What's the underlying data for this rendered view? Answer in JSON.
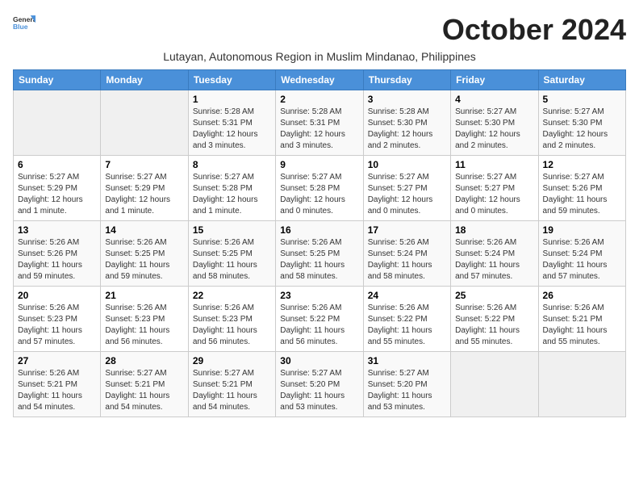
{
  "logo": {
    "line1": "General",
    "line2": "Blue"
  },
  "title": "October 2024",
  "subtitle": "Lutayan, Autonomous Region in Muslim Mindanao, Philippines",
  "days_of_week": [
    "Sunday",
    "Monday",
    "Tuesday",
    "Wednesday",
    "Thursday",
    "Friday",
    "Saturday"
  ],
  "weeks": [
    [
      {
        "day": "",
        "info": ""
      },
      {
        "day": "",
        "info": ""
      },
      {
        "day": "1",
        "info": "Sunrise: 5:28 AM\nSunset: 5:31 PM\nDaylight: 12 hours and 3 minutes."
      },
      {
        "day": "2",
        "info": "Sunrise: 5:28 AM\nSunset: 5:31 PM\nDaylight: 12 hours and 3 minutes."
      },
      {
        "day": "3",
        "info": "Sunrise: 5:28 AM\nSunset: 5:30 PM\nDaylight: 12 hours and 2 minutes."
      },
      {
        "day": "4",
        "info": "Sunrise: 5:27 AM\nSunset: 5:30 PM\nDaylight: 12 hours and 2 minutes."
      },
      {
        "day": "5",
        "info": "Sunrise: 5:27 AM\nSunset: 5:30 PM\nDaylight: 12 hours and 2 minutes."
      }
    ],
    [
      {
        "day": "6",
        "info": "Sunrise: 5:27 AM\nSunset: 5:29 PM\nDaylight: 12 hours and 1 minute."
      },
      {
        "day": "7",
        "info": "Sunrise: 5:27 AM\nSunset: 5:29 PM\nDaylight: 12 hours and 1 minute."
      },
      {
        "day": "8",
        "info": "Sunrise: 5:27 AM\nSunset: 5:28 PM\nDaylight: 12 hours and 1 minute."
      },
      {
        "day": "9",
        "info": "Sunrise: 5:27 AM\nSunset: 5:28 PM\nDaylight: 12 hours and 0 minutes."
      },
      {
        "day": "10",
        "info": "Sunrise: 5:27 AM\nSunset: 5:27 PM\nDaylight: 12 hours and 0 minutes."
      },
      {
        "day": "11",
        "info": "Sunrise: 5:27 AM\nSunset: 5:27 PM\nDaylight: 12 hours and 0 minutes."
      },
      {
        "day": "12",
        "info": "Sunrise: 5:27 AM\nSunset: 5:26 PM\nDaylight: 11 hours and 59 minutes."
      }
    ],
    [
      {
        "day": "13",
        "info": "Sunrise: 5:26 AM\nSunset: 5:26 PM\nDaylight: 11 hours and 59 minutes."
      },
      {
        "day": "14",
        "info": "Sunrise: 5:26 AM\nSunset: 5:25 PM\nDaylight: 11 hours and 59 minutes."
      },
      {
        "day": "15",
        "info": "Sunrise: 5:26 AM\nSunset: 5:25 PM\nDaylight: 11 hours and 58 minutes."
      },
      {
        "day": "16",
        "info": "Sunrise: 5:26 AM\nSunset: 5:25 PM\nDaylight: 11 hours and 58 minutes."
      },
      {
        "day": "17",
        "info": "Sunrise: 5:26 AM\nSunset: 5:24 PM\nDaylight: 11 hours and 58 minutes."
      },
      {
        "day": "18",
        "info": "Sunrise: 5:26 AM\nSunset: 5:24 PM\nDaylight: 11 hours and 57 minutes."
      },
      {
        "day": "19",
        "info": "Sunrise: 5:26 AM\nSunset: 5:24 PM\nDaylight: 11 hours and 57 minutes."
      }
    ],
    [
      {
        "day": "20",
        "info": "Sunrise: 5:26 AM\nSunset: 5:23 PM\nDaylight: 11 hours and 57 minutes."
      },
      {
        "day": "21",
        "info": "Sunrise: 5:26 AM\nSunset: 5:23 PM\nDaylight: 11 hours and 56 minutes."
      },
      {
        "day": "22",
        "info": "Sunrise: 5:26 AM\nSunset: 5:23 PM\nDaylight: 11 hours and 56 minutes."
      },
      {
        "day": "23",
        "info": "Sunrise: 5:26 AM\nSunset: 5:22 PM\nDaylight: 11 hours and 56 minutes."
      },
      {
        "day": "24",
        "info": "Sunrise: 5:26 AM\nSunset: 5:22 PM\nDaylight: 11 hours and 55 minutes."
      },
      {
        "day": "25",
        "info": "Sunrise: 5:26 AM\nSunset: 5:22 PM\nDaylight: 11 hours and 55 minutes."
      },
      {
        "day": "26",
        "info": "Sunrise: 5:26 AM\nSunset: 5:21 PM\nDaylight: 11 hours and 55 minutes."
      }
    ],
    [
      {
        "day": "27",
        "info": "Sunrise: 5:26 AM\nSunset: 5:21 PM\nDaylight: 11 hours and 54 minutes."
      },
      {
        "day": "28",
        "info": "Sunrise: 5:27 AM\nSunset: 5:21 PM\nDaylight: 11 hours and 54 minutes."
      },
      {
        "day": "29",
        "info": "Sunrise: 5:27 AM\nSunset: 5:21 PM\nDaylight: 11 hours and 54 minutes."
      },
      {
        "day": "30",
        "info": "Sunrise: 5:27 AM\nSunset: 5:20 PM\nDaylight: 11 hours and 53 minutes."
      },
      {
        "day": "31",
        "info": "Sunrise: 5:27 AM\nSunset: 5:20 PM\nDaylight: 11 hours and 53 minutes."
      },
      {
        "day": "",
        "info": ""
      },
      {
        "day": "",
        "info": ""
      }
    ]
  ]
}
